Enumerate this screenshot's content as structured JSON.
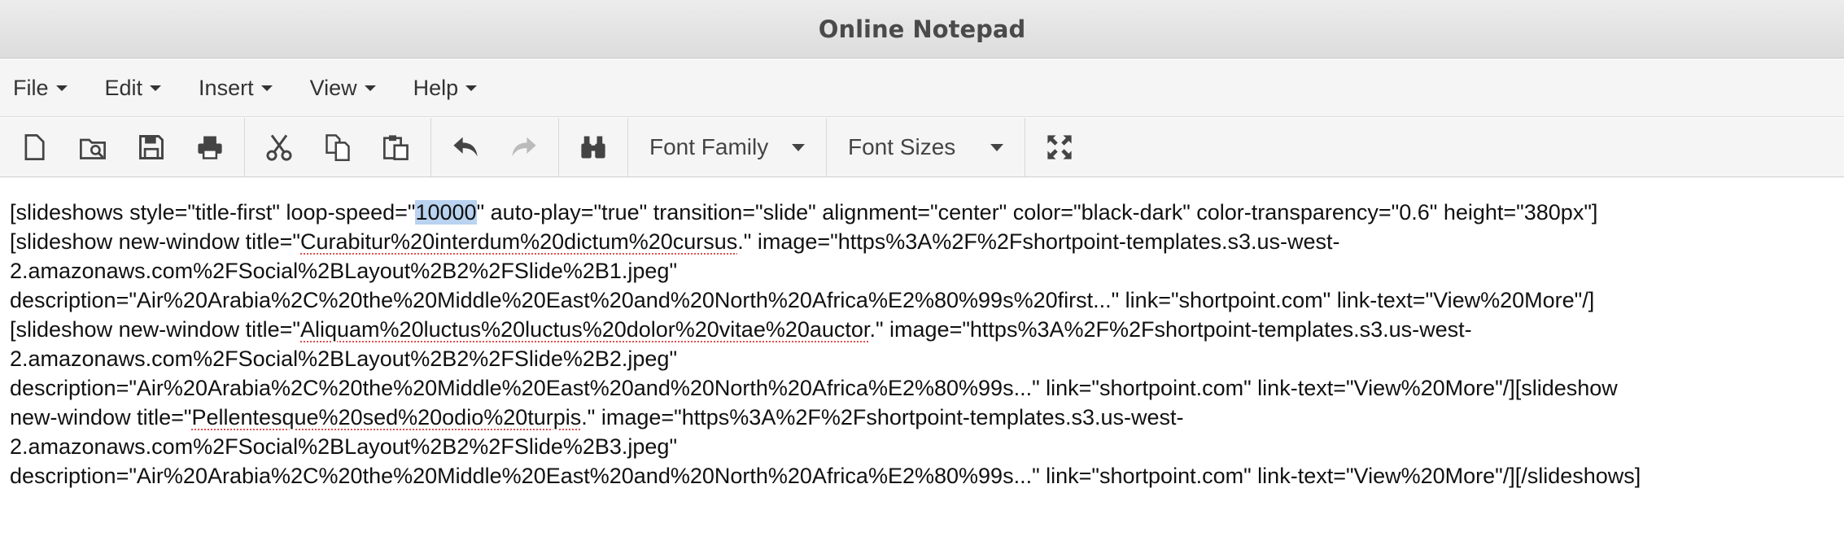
{
  "window": {
    "title": "Online Notepad"
  },
  "menu": [
    {
      "label": "File"
    },
    {
      "label": "Edit"
    },
    {
      "label": "Insert"
    },
    {
      "label": "View"
    },
    {
      "label": "Help"
    }
  ],
  "toolbar": {
    "font_family": "Font Family",
    "font_sizes": "Font Sizes",
    "icons": [
      "new-file-icon",
      "open-file-icon",
      "save-icon",
      "print-icon",
      "cut-icon",
      "copy-icon",
      "paste-icon",
      "undo-icon",
      "redo-icon",
      "find-icon",
      "fullscreen-icon"
    ]
  },
  "editor": {
    "lines": [
      {
        "segments": [
          {
            "text": "[slideshows style=\"title-first\" loop-speed=\""
          },
          {
            "text": "10000",
            "selected": true
          },
          {
            "text": "\" auto-play=\"true\" transition=\"slide\" alignment=\"center\" color=\"black-dark\" color-transparency=\"0.6\" height=\"380px\"]"
          }
        ]
      },
      {
        "segments": [
          {
            "text": "[slideshow new-window title=\""
          },
          {
            "text": "Curabitur%20interdum%20dictum%20cursus",
            "misspelled": true
          },
          {
            "text": ".\" image=\"https%3A%2F%2Fshortpoint-templates.s3.us-west-"
          }
        ]
      },
      {
        "segments": [
          {
            "text": "2.amazonaws.com%2FSocial%2BLayout%2B2%2FSlide%2B1.jpeg\""
          }
        ]
      },
      {
        "segments": [
          {
            "text": "description=\"Air%20Arabia%2C%20the%20Middle%20East%20and%20North%20Africa%E2%80%99s%20first...\" link=\"shortpoint.com\" link-text=\"View%20More\"/]"
          }
        ]
      },
      {
        "segments": [
          {
            "text": "[slideshow new-window title=\""
          },
          {
            "text": "Aliquam%20luctus%20luctus%20dolor%20vitae%20auctor",
            "misspelled": true
          },
          {
            "text": ".\" image=\"https%3A%2F%2Fshortpoint-templates.s3.us-west-"
          }
        ]
      },
      {
        "segments": [
          {
            "text": "2.amazonaws.com%2FSocial%2BLayout%2B2%2FSlide%2B2.jpeg\""
          }
        ]
      },
      {
        "segments": [
          {
            "text": "description=\"Air%20Arabia%2C%20the%20Middle%20East%20and%20North%20Africa%E2%80%99s...\" link=\"shortpoint.com\" link-text=\"View%20More\"/][slideshow"
          }
        ]
      },
      {
        "segments": [
          {
            "text": "new-window title=\""
          },
          {
            "text": "Pellentesque%20sed%20odio%20turpis",
            "misspelled": true
          },
          {
            "text": ".\" image=\"https%3A%2F%2Fshortpoint-templates.s3.us-west-"
          }
        ]
      },
      {
        "segments": [
          {
            "text": "2.amazonaws.com%2FSocial%2BLayout%2B2%2FSlide%2B3.jpeg\""
          }
        ]
      },
      {
        "segments": [
          {
            "text": "description=\"Air%20Arabia%2C%20the%20Middle%20East%20and%20North%20Africa%E2%80%99s...\" link=\"shortpoint.com\" link-text=\"View%20More\"/][/slideshows]"
          }
        ]
      }
    ]
  }
}
